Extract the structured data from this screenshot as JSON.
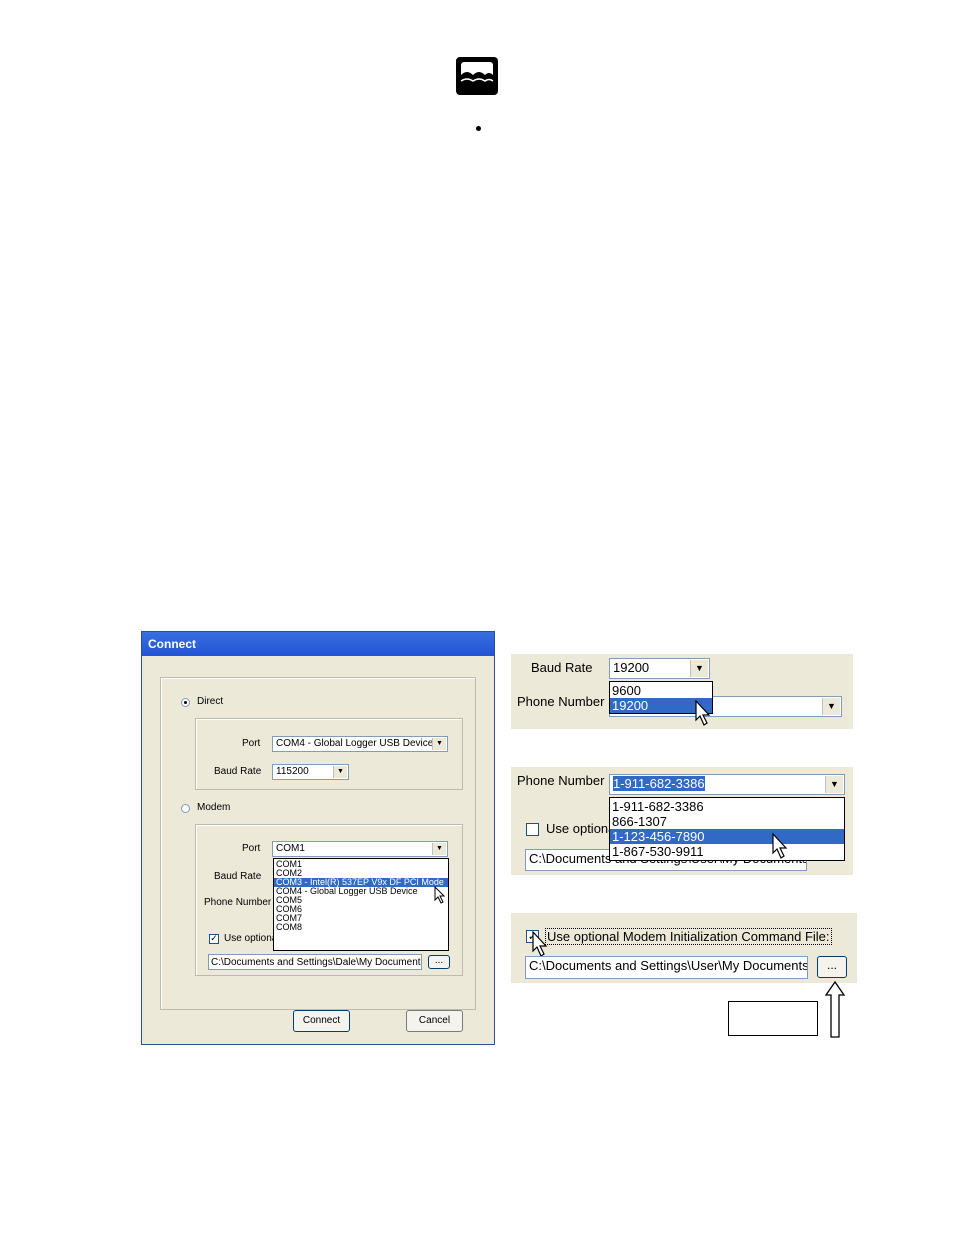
{
  "dialog": {
    "title": "Connect",
    "direct": {
      "label": "Direct",
      "port_label": "Port",
      "port_value": "COM4 - Global Logger USB Device",
      "baud_label": "Baud Rate",
      "baud_value": "115200"
    },
    "modem": {
      "label": "Modem",
      "port_label": "Port",
      "port_value": "COM1",
      "baud_label": "Baud Rate",
      "phone_label": "Phone Number",
      "port_options": [
        "COM1",
        "COM2",
        "COM3 - Intel(R) 537EP V9x DF PCI Mode",
        "COM4 - Global Logger USB Device",
        "COM5",
        "COM6",
        "COM7",
        "COM8"
      ],
      "use_optional_label": "Use optional",
      "path_value": "C:\\Documents and Settings\\Dale\\My Documents",
      "browse_label": "..."
    },
    "connect_label": "Connect",
    "cancel_label": "Cancel"
  },
  "zoom1": {
    "baud_label": "Baud Rate",
    "baud_value": "19200",
    "baud_options": [
      "9600",
      "19200"
    ],
    "phone_label": "Phone Number"
  },
  "zoom2": {
    "phone_label": "Phone Number",
    "phone_value": "1-911-682-3386",
    "phone_options": [
      "1-911-682-3386",
      "866-1307",
      "1-123-456-7890",
      "1-867-530-9911"
    ],
    "use_optional_label": "Use optiona",
    "path_value": "C:\\Documents and Settings\\User\\My Documents"
  },
  "zoom3": {
    "use_optional_label": "Use optional Modem Initialization Command File:",
    "path_value": "C:\\Documents and Settings\\User\\My Documents",
    "browse_label": "..."
  },
  "colors": {
    "selection": "#316ac5",
    "dialog_face": "#ece9d8",
    "titlebar": "#2253d6"
  }
}
